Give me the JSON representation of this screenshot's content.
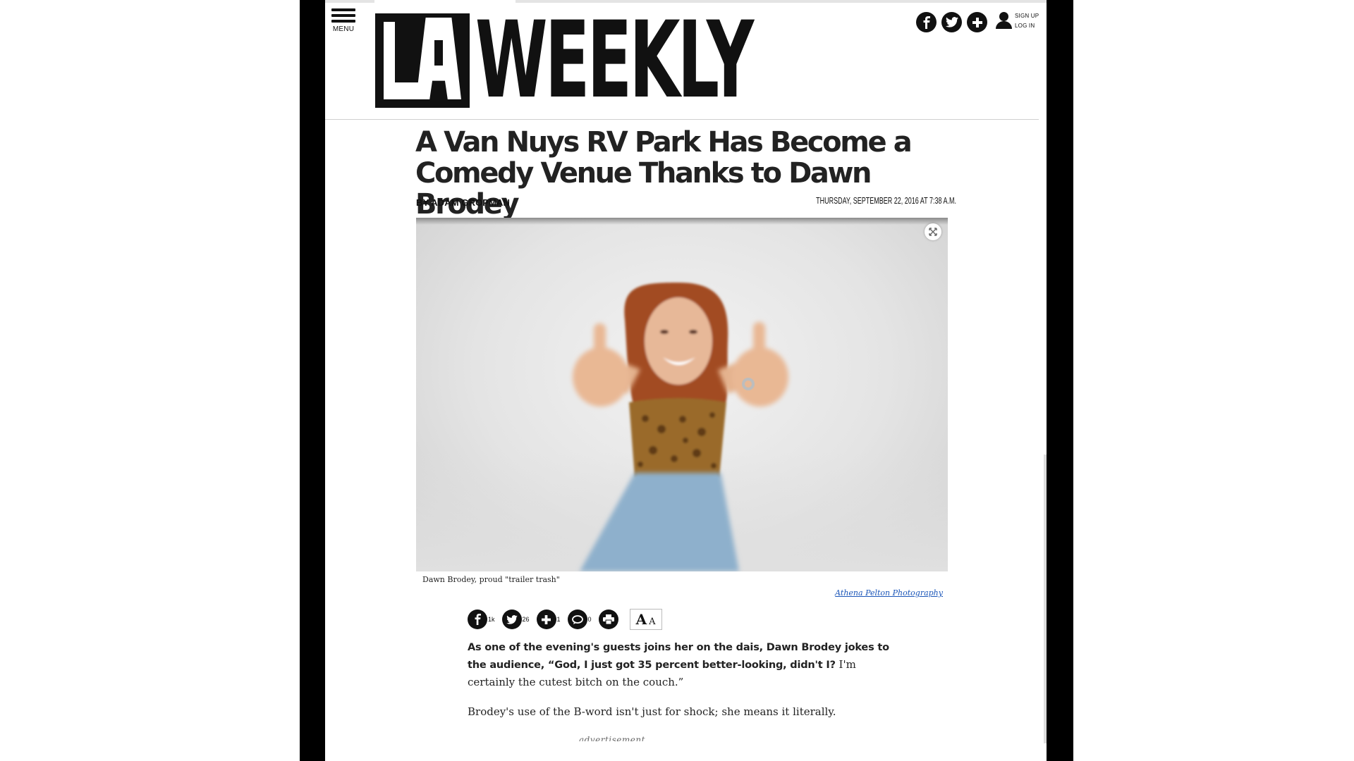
{
  "header": {
    "menu_label": "MENU",
    "logo_text": "LA WEEKLY",
    "logo_la": "LA",
    "logo_weekly": "WEEKLY",
    "sign_up": "SIGN UP",
    "log_in": "LOG IN",
    "social": [
      "facebook-icon",
      "twitter-icon",
      "plus-icon"
    ]
  },
  "article": {
    "headline": "A Van Nuys RV Park Has Become a Comedy Venue Thanks to Dawn Brodey",
    "byline_prefix": "BY",
    "author": "ADAM GROPMAN",
    "dateline": "THURSDAY, SEPTEMBER 22, 2016 AT 7:38 A.M.",
    "caption": "Dawn Brodey, proud \"trailer trash\"",
    "credit": "Athena Pelton Photography",
    "lead_bold": "As one of the evening's guests joins her on the dais, Dawn Brodey jokes to the audience, “God, I just got 35 percent better-looking, didn't I?",
    "lead_rest": " I'm certainly the cutest bitch on the couch.”",
    "paragraph2": "Brodey's use of the B-word isn't just for shock; she means it literally.",
    "ad_label": "advertisement"
  },
  "share": {
    "facebook_count": "1k",
    "twitter_count": "26",
    "plus_count": "1",
    "comments_count": "0",
    "textsize_big": "A",
    "textsize_small": "A"
  },
  "colors": {
    "ink": "#111111",
    "link": "#1a55b8",
    "divider": "#cfcfcf"
  }
}
